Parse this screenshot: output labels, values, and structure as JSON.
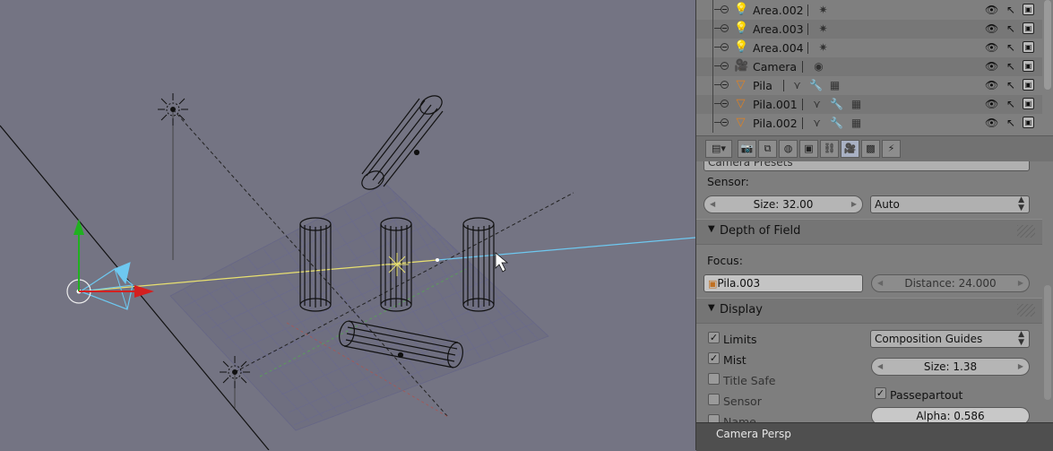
{
  "viewport": {
    "label": "Camera Persp"
  },
  "outliner": {
    "items": [
      {
        "name": "Area.002",
        "icon": "lamp-icon"
      },
      {
        "name": "Area.003",
        "icon": "lamp-icon"
      },
      {
        "name": "Area.004",
        "icon": "lamp-icon"
      },
      {
        "name": "Camera",
        "icon": "camera-icon"
      },
      {
        "name": "Pila",
        "icon": "mesh-icon"
      },
      {
        "name": "Pila.001",
        "icon": "mesh-icon"
      },
      {
        "name": "Pila.002",
        "icon": "mesh-icon"
      }
    ]
  },
  "properties": {
    "presets_label": "Camera Presets",
    "sensor_label": "Sensor:",
    "sensor_size": "Size: 32.00",
    "sensor_fit": "Auto",
    "dof": {
      "title": "Depth of Field",
      "focus_label": "Focus:",
      "focus_object": "Pila.003",
      "distance": "Distance: 24.000"
    },
    "display": {
      "title": "Display",
      "limits": "Limits",
      "mist": "Mist",
      "title_safe": "Title Safe",
      "sensor": "Sensor",
      "name": "Name",
      "composition": "Composition Guides",
      "size": "Size: 1.38",
      "passepartout": "Passepartout",
      "alpha": "Alpha: 0.586"
    }
  },
  "colors": {
    "viewport_bg": "#747483",
    "panel_bg": "#7e7e7e",
    "x_axis": "#d42020",
    "y_axis": "#20b020",
    "camera": "#6ec8f0",
    "selected_line": "#e8e070"
  }
}
